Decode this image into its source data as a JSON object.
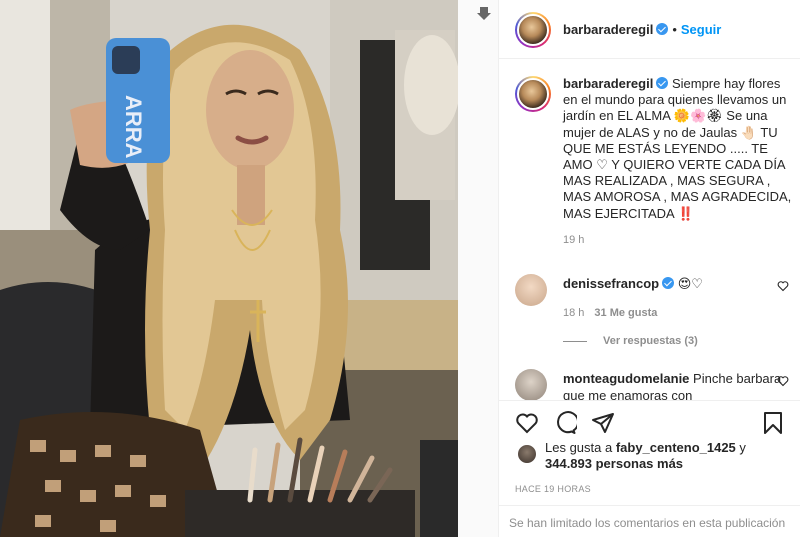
{
  "post": {
    "username": "barbaraderegil",
    "follow_label": "Seguir",
    "dot": "•"
  },
  "caption": {
    "username": "barbaraderegil",
    "text": "Siempre hay flores en el mundo para quienes llevamos un jardín en EL ALMA 🌼🌸🏵 Se una mujer de ALAS y no de Jaulas 🤚🏻 TU QUE ME ESTÁS LEYENDO ..... TE AMO ♡ Y QUIERO VERTE CADA DÍA MAS REALIZADA , MAS SEGURA , MAS AMOROSA , MAS AGRADECIDA, MAS EJERCITADA ‼️",
    "time": "19 h"
  },
  "comments": [
    {
      "username": "denissefrancop",
      "text": "😍♡",
      "time": "18 h",
      "likes": "31 Me gusta",
      "replies": "Ver respuestas (3)"
    },
    {
      "username": "monteagudomelanie",
      "text": "Pinche barbara que me enamoras con"
    }
  ],
  "likes": {
    "prefix": "Les gusta a ",
    "first_user": "faby_centeno_1425",
    "middle": " y ",
    "count": "344.893 personas más"
  },
  "time_ago": "HACE 19 HORAS",
  "comments_limited": "Se han limitado los comentarios en esta publicación",
  "icons": {
    "download": "download-arrow-icon",
    "like": "heart-icon",
    "comment": "comment-bubble-icon",
    "share": "paper-plane-icon",
    "save": "bookmark-icon"
  },
  "colors": {
    "accent": "#0095f6",
    "verified": "#3897f0",
    "muted": "#8e8e8e",
    "text": "#262626",
    "border": "#efefef"
  }
}
